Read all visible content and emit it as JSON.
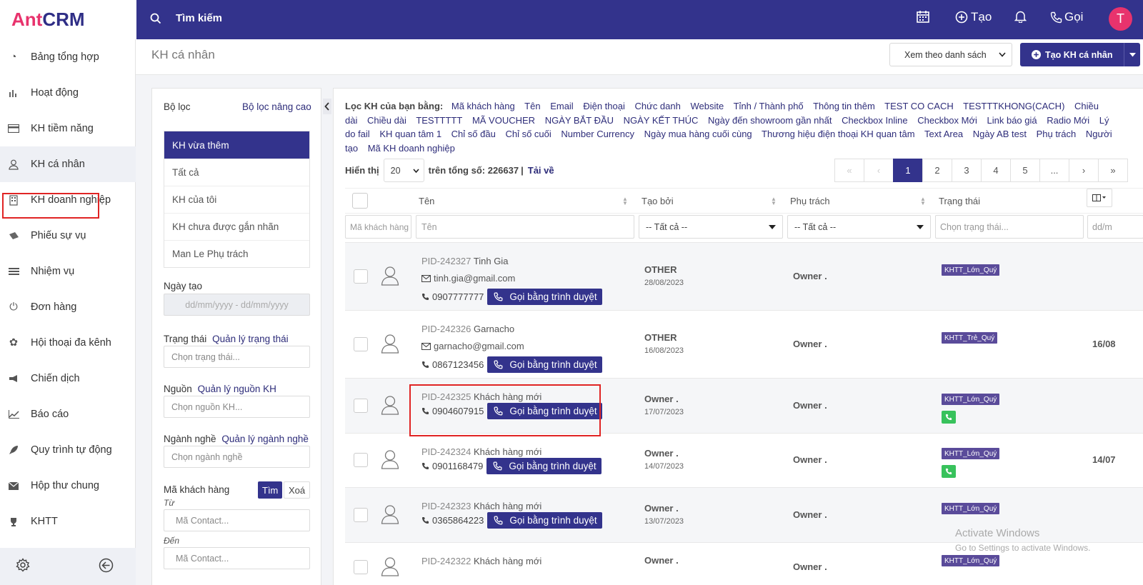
{
  "brand": {
    "logo_pink": "Ant",
    "logo_blue": "CRM",
    "brand_color": "#33338c",
    "accent": "#e8336d"
  },
  "topbar": {
    "search_label": "Tìm kiếm",
    "create_label": "Tạo",
    "call_label": "Gọi",
    "avatar_letter": "T"
  },
  "sidebar": {
    "items": [
      {
        "label": "Bảng tổng hợp",
        "icon": "dashboard-icon"
      },
      {
        "label": "Hoạt động",
        "icon": "bar-chart-icon"
      },
      {
        "label": "KH tiềm năng",
        "icon": "card-icon"
      },
      {
        "label": "KH cá nhân",
        "icon": "user-icon"
      },
      {
        "label": "KH doanh nghiệp",
        "icon": "building-icon"
      },
      {
        "label": "Phiếu sự vụ",
        "icon": "ticket-icon"
      },
      {
        "label": "Nhiệm vụ",
        "icon": "tasks-icon"
      },
      {
        "label": "Đơn hàng",
        "icon": "order-icon"
      },
      {
        "label": "Hội thoại đa kênh",
        "icon": "chat-icon"
      },
      {
        "label": "Chiến dịch",
        "icon": "megaphone-icon"
      },
      {
        "label": "Báo cáo",
        "icon": "line-chart-icon"
      },
      {
        "label": "Quy trình tự động",
        "icon": "rocket-icon"
      },
      {
        "label": "Hộp thư chung",
        "icon": "envelope-icon"
      },
      {
        "label": "KHTT",
        "icon": "trophy-icon"
      }
    ]
  },
  "header": {
    "title": "KH cá nhân",
    "view_select": "Xem theo danh sách",
    "create_button": "Tạo KH cá nhân"
  },
  "filter": {
    "title": "Bộ lọc",
    "advanced": "Bộ lọc nâng cao",
    "lists": [
      "KH vừa thêm",
      "Tất cả",
      "KH của tôi",
      "KH chưa được gắn nhãn",
      "Man Le Phụ trách"
    ],
    "date_label": "Ngày tạo",
    "date_placeholder": "dd/mm/yyyy - dd/mm/yyyy",
    "status_label": "Trạng thái",
    "status_link": "Quản lý trạng thái",
    "status_placeholder": "Chọn trạng thái...",
    "source_label": "Nguồn",
    "source_link": "Quản lý nguồn KH",
    "source_placeholder": "Chọn nguồn KH...",
    "industry_label": "Ngành nghề",
    "industry_link": "Quản lý ngành nghề",
    "industry_placeholder": "Chọn ngành nghề",
    "code_label": "Mã khách hàng",
    "search_btn": "Tìm",
    "clear_btn": "Xoá",
    "from_label": "Từ",
    "to_label": "Đến",
    "code_placeholder": "Mã Contact..."
  },
  "filter_by": {
    "label": "Lọc KH của bạn bằng:",
    "fields": [
      "Mã khách hàng",
      "Tên",
      "Email",
      "Điện thoại",
      "Chức danh",
      "Website",
      "Tỉnh / Thành phố",
      "Thông tin thêm",
      "TEST CO CACH",
      "TESTTTKHONG(CACH)",
      "Chiều dài",
      "Chiều dài",
      "TESTTTTT",
      "MÃ VOUCHER",
      "NGÀY BẮT ĐẦU",
      "NGÀY KẾT THÚC",
      "Ngày đến showroom gần nhất",
      "Checkbox Inline",
      "Checkbox Mới",
      "Link báo giá",
      "Radio Mới",
      "Lý do fail",
      "KH quan tâm 1",
      "Chỉ số đầu",
      "Chỉ số cuối",
      "Number Currency",
      "Ngày mua hàng cuối cùng",
      "Thương hiệu điện thoại KH quan tâm",
      "Text Area",
      "Ngày AB test",
      "Phụ trách",
      "Người tạo",
      "Mã KH doanh nghiệp"
    ]
  },
  "list": {
    "show_label": "Hiển thị",
    "page_size": "20",
    "total_text": "trên tổng số: 226637",
    "download": "Tải về",
    "pages": [
      "«",
      "‹",
      "1",
      "2",
      "3",
      "4",
      "5",
      "...",
      "›",
      "»"
    ],
    "current_page": "1"
  },
  "table": {
    "columns": [
      "Tên",
      "Tạo bởi",
      "Phụ trách",
      "Trạng thái"
    ],
    "filters": {
      "code": "Mã khách hàng",
      "name": "Tên",
      "creator": "-- Tất cả --",
      "owner": "-- Tất cả --",
      "status": "Chọn trạng thái...",
      "date": "dd/m"
    },
    "call_button": "Gọi bằng trình duyệt",
    "rows": [
      {
        "pid": "PID-242327",
        "name": "Tinh Gia",
        "email": "tinh.gia@gmail.com",
        "phone": "0907777777",
        "creator": "OTHER",
        "date": "28/08/2023",
        "owner": "Owner .",
        "tag": "KHTT_Lớn_Quý",
        "extra": ""
      },
      {
        "pid": "PID-242326",
        "name": "Garnacho",
        "email": "garnacho@gmail.com",
        "phone": "0867123456",
        "creator": "OTHER",
        "date": "16/08/2023",
        "owner": "Owner .",
        "tag": "KHTT_Trẻ_Quý",
        "extra": "16/08"
      },
      {
        "pid": "PID-242325",
        "name": "Khách hàng mới",
        "email": "",
        "phone": "0904607915",
        "creator": "Owner .",
        "date": "17/07/2023",
        "owner": "Owner .",
        "tag": "KHTT_Lớn_Quý",
        "extra": ""
      },
      {
        "pid": "PID-242324",
        "name": "Khách hàng mới",
        "email": "",
        "phone": "0901168479",
        "creator": "Owner .",
        "date": "14/07/2023",
        "owner": "Owner .",
        "tag": "KHTT_Lớn_Quý",
        "extra": "14/07"
      },
      {
        "pid": "PID-242323",
        "name": "Khách hàng mới",
        "email": "",
        "phone": "0365864223",
        "creator": "Owner .",
        "date": "13/07/2023",
        "owner": "Owner .",
        "tag": "KHTT_Lớn_Quý",
        "extra": ""
      },
      {
        "pid": "PID-242322",
        "name": "Khách hàng mới",
        "email": "",
        "phone": "",
        "creator": "Owner .",
        "date": "",
        "owner": "Owner .",
        "tag": "KHTT_Lớn_Quý",
        "extra": ""
      }
    ]
  },
  "watermark": {
    "line1": "Activate Windows",
    "line2": "Go to Settings to activate Windows."
  }
}
